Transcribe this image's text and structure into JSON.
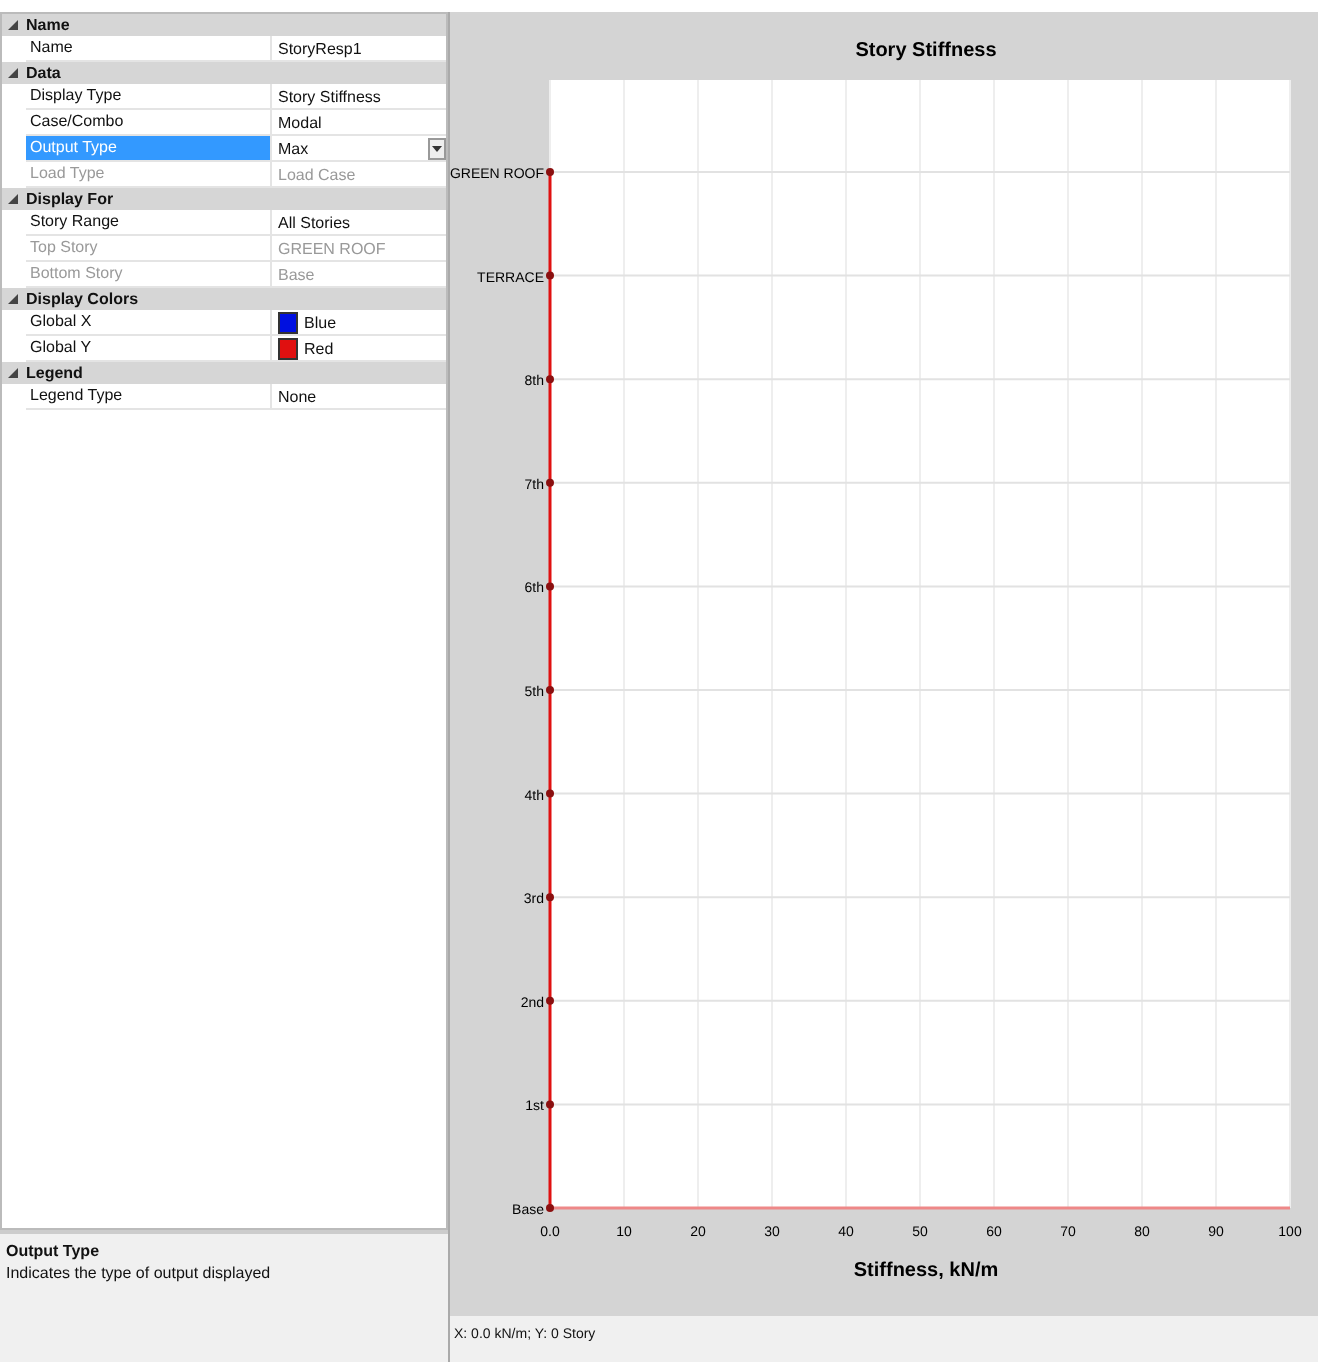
{
  "properties": {
    "groups": [
      {
        "title": "Name",
        "expanded": true,
        "rows": [
          {
            "kind": "text",
            "label": "Name",
            "value": "StoryResp1",
            "selected": false,
            "disabled": false
          }
        ]
      },
      {
        "title": "Data",
        "expanded": true,
        "rows": [
          {
            "kind": "text",
            "label": "Display Type",
            "value": "Story Stiffness",
            "selected": false,
            "disabled": false
          },
          {
            "kind": "text",
            "label": "Case/Combo",
            "value": "Modal",
            "selected": false,
            "disabled": false
          },
          {
            "kind": "dropdown",
            "label": "Output Type",
            "value": "Max",
            "selected": true,
            "disabled": false
          },
          {
            "kind": "text",
            "label": "Load Type",
            "value": "Load Case",
            "selected": false,
            "disabled": true
          }
        ]
      },
      {
        "title": "Display For",
        "expanded": true,
        "rows": [
          {
            "kind": "text",
            "label": "Story Range",
            "value": "All Stories",
            "selected": false,
            "disabled": false
          },
          {
            "kind": "text",
            "label": "Top Story",
            "value": "GREEN ROOF",
            "selected": false,
            "disabled": true
          },
          {
            "kind": "text",
            "label": "Bottom Story",
            "value": "Base",
            "selected": false,
            "disabled": true
          }
        ]
      },
      {
        "title": "Display Colors",
        "expanded": true,
        "rows": [
          {
            "kind": "color",
            "label": "Global X",
            "value": "Blue",
            "color": "#0010e0",
            "selected": false,
            "disabled": false
          },
          {
            "kind": "color",
            "label": "Global Y",
            "value": "Red",
            "color": "#e01010",
            "selected": false,
            "disabled": false
          }
        ]
      },
      {
        "title": "Legend",
        "expanded": true,
        "rows": [
          {
            "kind": "text",
            "label": "Legend Type",
            "value": "None",
            "selected": false,
            "disabled": false
          }
        ]
      }
    ]
  },
  "description": {
    "title": "Output Type",
    "text": "Indicates the type of output displayed"
  },
  "chart": {
    "chart_data": {
      "type": "line",
      "orientation": "horizontal",
      "title": "Story Stiffness",
      "xlabel": "Stiffness, kN/m",
      "categories": [
        "GREEN ROOF",
        "TERRACE",
        "8th",
        "7th",
        "6th",
        "5th",
        "4th",
        "3rd",
        "2nd",
        "1st",
        "Base"
      ],
      "grid": true,
      "series": [
        {
          "marker": "circle",
          "color": "#e01010",
          "values": [
            0,
            0,
            0,
            0,
            0,
            0,
            0,
            0,
            0,
            0,
            0
          ]
        }
      ],
      "xlim": [
        0,
        100
      ],
      "xticks": [
        {
          "value": 0,
          "label": "0.0"
        },
        {
          "value": 10,
          "label": "10"
        },
        {
          "value": 20,
          "label": "20"
        },
        {
          "value": 30,
          "label": "30"
        },
        {
          "value": 40,
          "label": "40"
        },
        {
          "value": 50,
          "label": "50"
        },
        {
          "value": 60,
          "label": "60"
        },
        {
          "value": 70,
          "label": "70"
        },
        {
          "value": 80,
          "label": "80"
        },
        {
          "value": 90,
          "label": "90"
        },
        {
          "value": 100,
          "label": "100"
        }
      ]
    }
  },
  "status_bar": "X: 0.0 kN/m;  Y: 0 Story"
}
